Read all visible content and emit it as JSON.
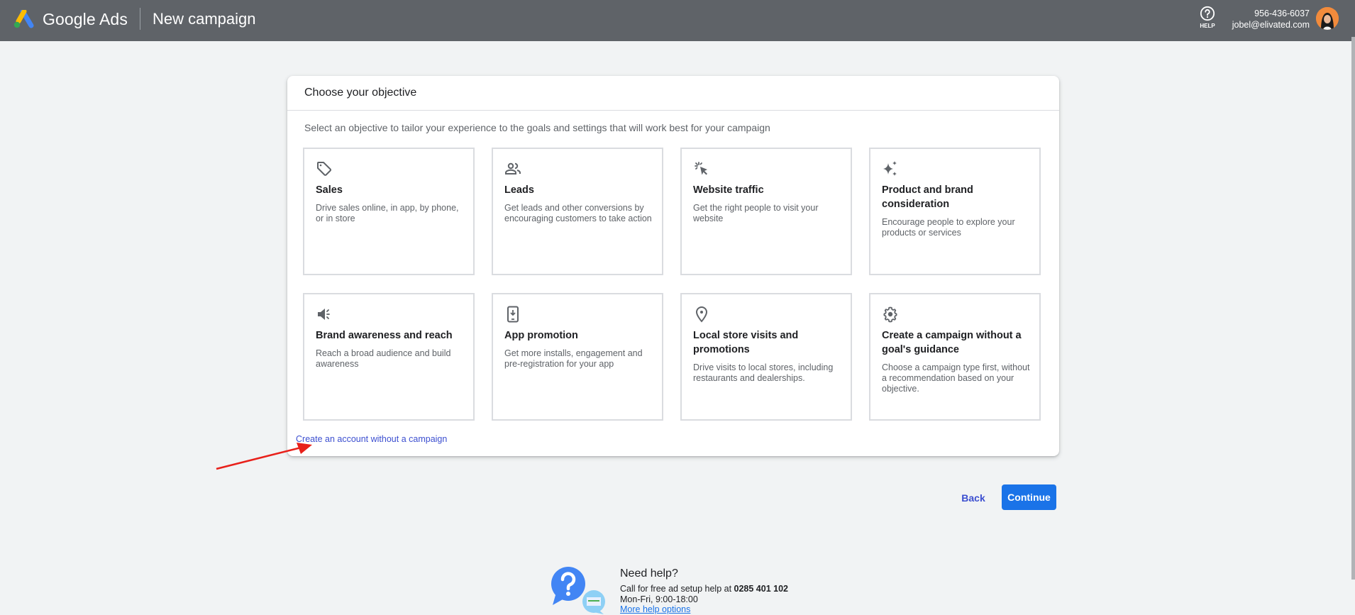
{
  "header": {
    "brand": "Google Ads",
    "page_title": "New campaign",
    "help_label": "HELP",
    "account_phone": "956-436-6037",
    "account_email": "jobel@elivated.com"
  },
  "card": {
    "title": "Choose your objective",
    "subtitle": "Select an objective to tailor your experience to the goals and settings that will work best for your campaign",
    "objectives": [
      {
        "icon": "tag-icon",
        "title": "Sales",
        "description": "Drive sales online, in app, by phone, or in store"
      },
      {
        "icon": "people-icon",
        "title": "Leads",
        "description": "Get leads and other conversions by encouraging customers to take action"
      },
      {
        "icon": "cursor-click-icon",
        "title": "Website traffic",
        "description": "Get the right people to visit your website"
      },
      {
        "icon": "sparkle-icon",
        "title": "Product and brand consideration",
        "description": "Encourage people to explore your products or services"
      },
      {
        "icon": "megaphone-icon",
        "title": "Brand awareness and reach",
        "description": "Reach a broad audience and build awareness"
      },
      {
        "icon": "phone-download-icon",
        "title": "App promotion",
        "description": "Get more installs, engagement and pre-registration for your app"
      },
      {
        "icon": "location-pin-icon",
        "title": "Local store visits and promotions",
        "description": "Drive visits to local stores, including restaurants and dealerships."
      },
      {
        "icon": "gear-icon",
        "title": "Create a campaign without a goal's guidance",
        "description": "Choose a campaign type first, without a recommendation based on your objective."
      }
    ],
    "create_account_link": "Create an account without a campaign"
  },
  "actions": {
    "back": "Back",
    "continue": "Continue"
  },
  "footer_help": {
    "title": "Need help?",
    "call_text": "Call for free ad setup help at ",
    "phone": "0285 401 102",
    "hours": "Mon-Fri, 9:00-18:00",
    "more_link": "More help options"
  },
  "colors": {
    "header_bg": "#5f6368",
    "primary": "#1a73e8",
    "link": "#3c4fd0",
    "annotation_arrow": "#e8201a"
  }
}
